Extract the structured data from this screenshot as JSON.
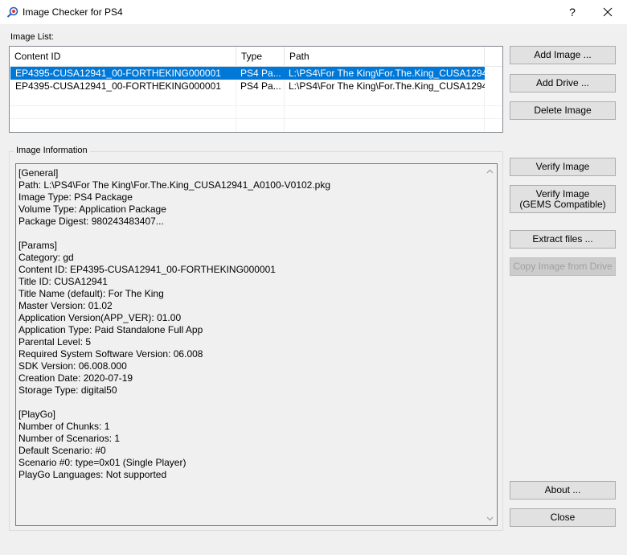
{
  "window": {
    "title": "Image Checker for PS4",
    "help_label": "?",
    "icon": "magnifier-app-icon"
  },
  "image_list": {
    "label": "Image List:",
    "columns": [
      "Content ID",
      "Type",
      "Path"
    ],
    "rows": [
      {
        "content_id": "EP4395-CUSA12941_00-FORTHEKING000001",
        "type": "PS4 Pa...",
        "path": "L:\\PS4\\For The King\\For.The.King_CUSA1294...",
        "selected": true
      },
      {
        "content_id": "EP4395-CUSA12941_00-FORTHEKING000001",
        "type": "PS4 Pa...",
        "path": "L:\\PS4\\For The King\\For.The.King_CUSA1294...",
        "selected": false
      }
    ]
  },
  "image_info": {
    "label": "Image Information",
    "text": "[General]\nPath: L:\\PS4\\For The King\\For.The.King_CUSA12941_A0100-V0102.pkg\nImage Type: PS4 Package\nVolume Type: Application Package\nPackage Digest: 980243483407...\n\n[Params]\nCategory: gd\nContent ID: EP4395-CUSA12941_00-FORTHEKING000001\nTitle ID: CUSA12941\nTitle Name (default): For The King\nMaster Version: 01.02\nApplication Version(APP_VER): 01.00\nApplication Type: Paid Standalone Full App\nParental Level: 5\nRequired System Software Version: 06.008\nSDK Version: 06.008.000\nCreation Date: 2020-07-19\nStorage Type: digital50\n\n[PlayGo]\nNumber of Chunks: 1\nNumber of Scenarios: 1\nDefault Scenario: #0\nScenario #0: type=0x01 (Single Player)\nPlayGo Languages: Not supported"
  },
  "buttons": {
    "add_image": "Add Image ...",
    "add_drive": "Add Drive ...",
    "delete_image": "Delete Image",
    "verify_image": "Verify Image",
    "verify_image_gems": "Verify Image\n(GEMS Compatible)",
    "extract_files": "Extract files ...",
    "copy_image_from_drive": "Copy Image from Drive",
    "about": "About ...",
    "close": "Close"
  },
  "colors": {
    "selection": "#0078d7",
    "window_bg": "#f0f0f0",
    "button_bg": "#e1e1e1"
  }
}
